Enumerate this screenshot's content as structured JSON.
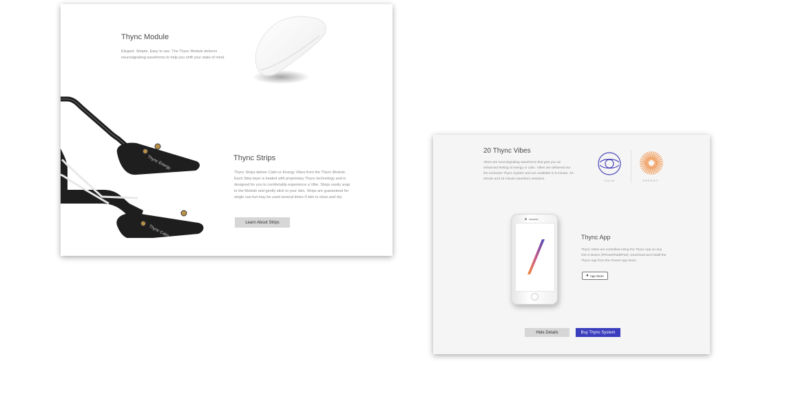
{
  "card1": {
    "module": {
      "title": "Thync Module",
      "body": "Elegant. Simple. Easy to use. The Thync Module delivers neurosignaling waveforms to help you shift your state of mind."
    },
    "strips": {
      "title": "Thync Strips",
      "body": "Thync Strips deliver Calm or Energy Vibes from the Thync Module. Each Strip layer is loaded with proprietary Thync technology and is designed for you to comfortably experience a Vibe. Strips easily snap to the Module and gently stick to your skin. Strips are guaranteed for single use but may be used several times if skin is clean and dry.",
      "button": "Learn About Strips",
      "energy_label": "Thync Energy",
      "calm_label": "Thync Calm"
    }
  },
  "card2": {
    "vibes": {
      "title": "20 Thync Vibes",
      "body": "Vibes are neurosignaling waveforms that give you an enhanced feeling of energy or calm. Vibes are delivered via the exclusive Thync System and are available in 5-minute, 10-minute and 15 minute waveform sessions.",
      "calm": "CALM",
      "energy": "ENERGY",
      "calm_color": "#4a47b8",
      "energy_color": "#f08a3c"
    },
    "app": {
      "title": "Thync App",
      "body": "Thync Vibes are controlled using the Thync App on any iOS 8 device (iPhone/iPad/iPod). Download and install the Thync App from the iTunes App Store.",
      "store_badge": "App Store"
    },
    "buttons": {
      "hide": "Hide Details",
      "buy": "Buy Thync System"
    }
  }
}
